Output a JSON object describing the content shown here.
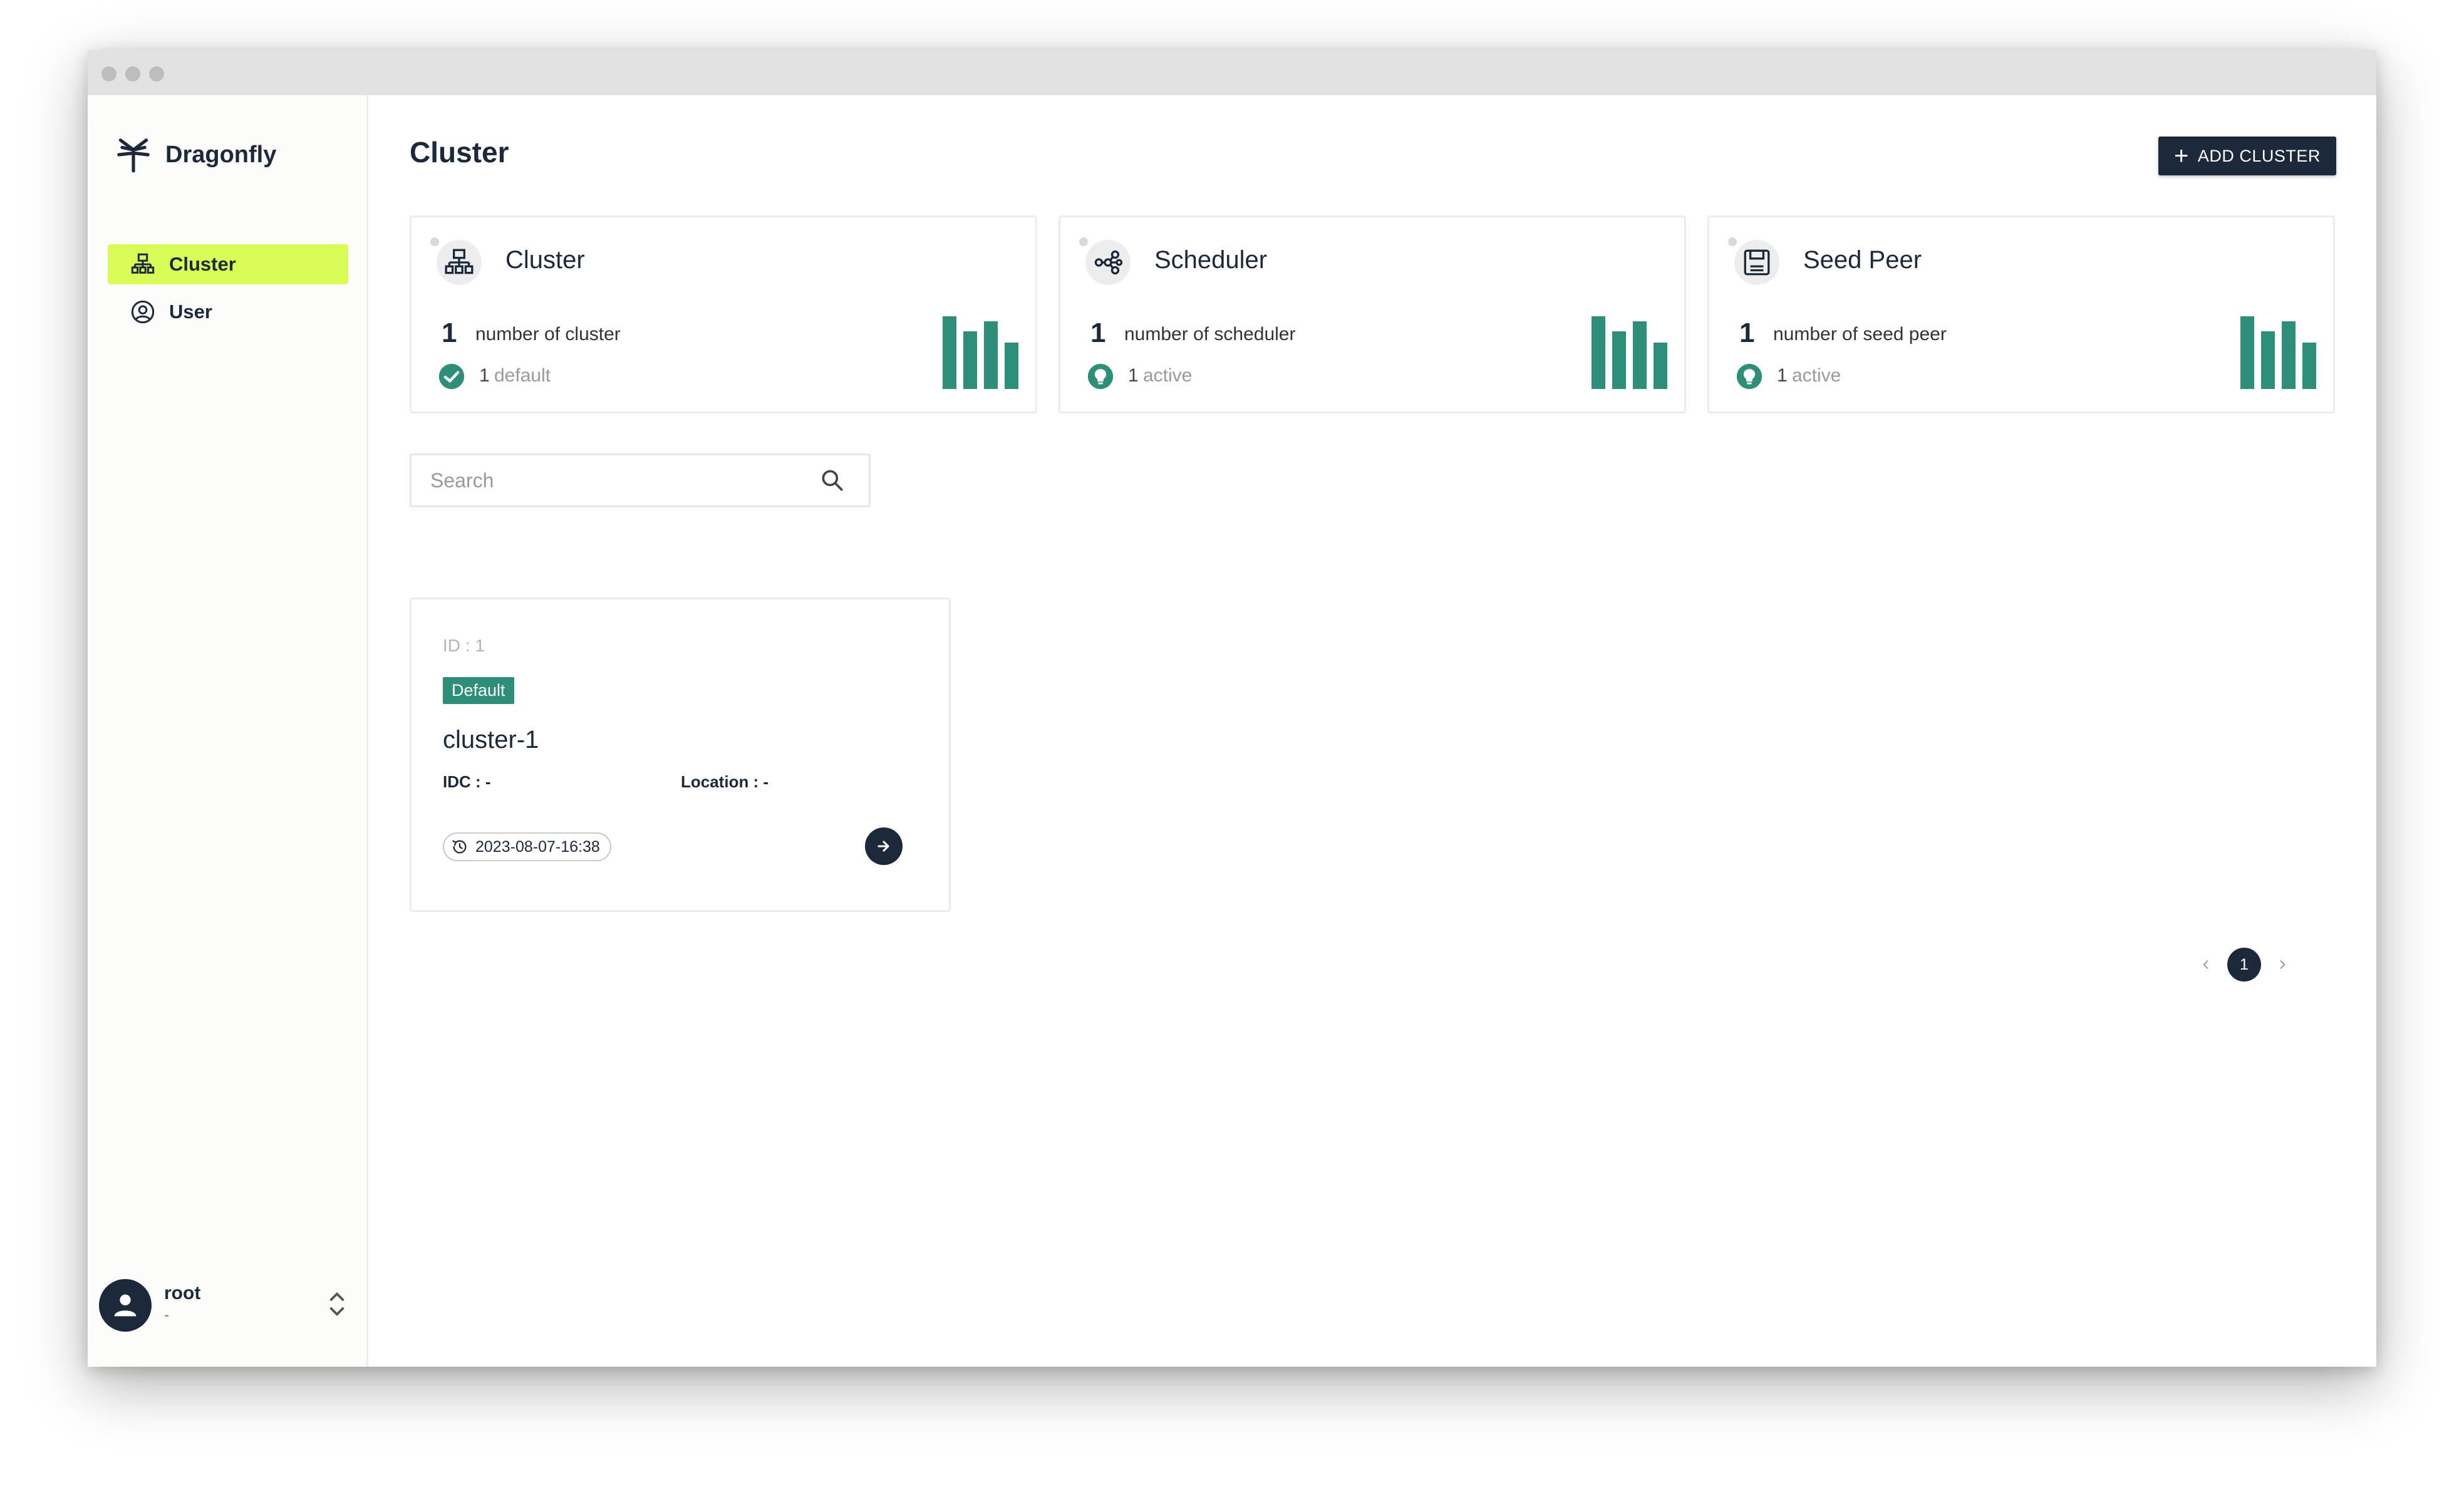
{
  "app": {
    "name": "Dragonfly"
  },
  "sidebar": {
    "items": [
      {
        "label": "Cluster",
        "icon": "cluster-icon",
        "active": true
      },
      {
        "label": "User",
        "icon": "user-circle-icon",
        "active": false
      }
    ],
    "account": {
      "name": "root",
      "sub": "-"
    }
  },
  "header": {
    "title": "Cluster",
    "add_button": "ADD CLUSTER"
  },
  "stats": [
    {
      "title": "Cluster",
      "count": "1",
      "label": "number of cluster",
      "sub_count": "1",
      "sub_label": "default",
      "icon": "cluster-icon",
      "status_icon": "check-circle-icon"
    },
    {
      "title": "Scheduler",
      "count": "1",
      "label": "number of scheduler",
      "sub_count": "1",
      "sub_label": "active",
      "icon": "scheduler-icon",
      "status_icon": "lightbulb-icon"
    },
    {
      "title": "Seed Peer",
      "count": "1",
      "label": "number of seed peer",
      "sub_count": "1",
      "sub_label": "active",
      "icon": "seed-peer-icon",
      "status_icon": "lightbulb-icon"
    }
  ],
  "search": {
    "placeholder": "Search",
    "value": ""
  },
  "clusters": [
    {
      "id_label": "ID : 1",
      "badge": "Default",
      "name": "cluster-1",
      "idc": "IDC : -",
      "location": "Location : -",
      "updated": "2023-08-07-16:38"
    }
  ],
  "pagination": {
    "current": "1"
  },
  "colors": {
    "navy": "#1c293a",
    "accent": "#dafc56",
    "green": "#2e8f79"
  }
}
